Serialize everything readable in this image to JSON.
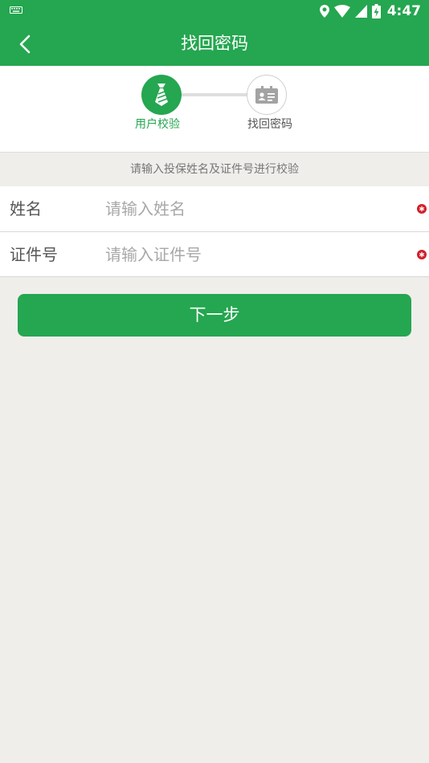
{
  "status_bar": {
    "time": "4:47",
    "icons": [
      "keyboard-icon",
      "location-icon",
      "wifi-icon",
      "signal-icon",
      "battery-charging-icon"
    ]
  },
  "app_bar": {
    "title": "找回密码",
    "back_icon": "chevron-left-icon"
  },
  "steps": {
    "items": [
      {
        "label": "用户校验",
        "icon": "tie-icon",
        "active": true
      },
      {
        "label": "找回密码",
        "icon": "id-card-icon",
        "active": false
      }
    ]
  },
  "form": {
    "hint": "请输入投保姓名及证件号进行校验",
    "fields": [
      {
        "label": "姓名",
        "value": "",
        "placeholder": "请输入姓名",
        "required": true
      },
      {
        "label": "证件号",
        "value": "",
        "placeholder": "请输入证件号",
        "required": true
      }
    ]
  },
  "actions": {
    "next_label": "下一步"
  },
  "colors": {
    "primary": "#25a650",
    "background": "#efeeeb",
    "required_mark": "#d0202a"
  }
}
